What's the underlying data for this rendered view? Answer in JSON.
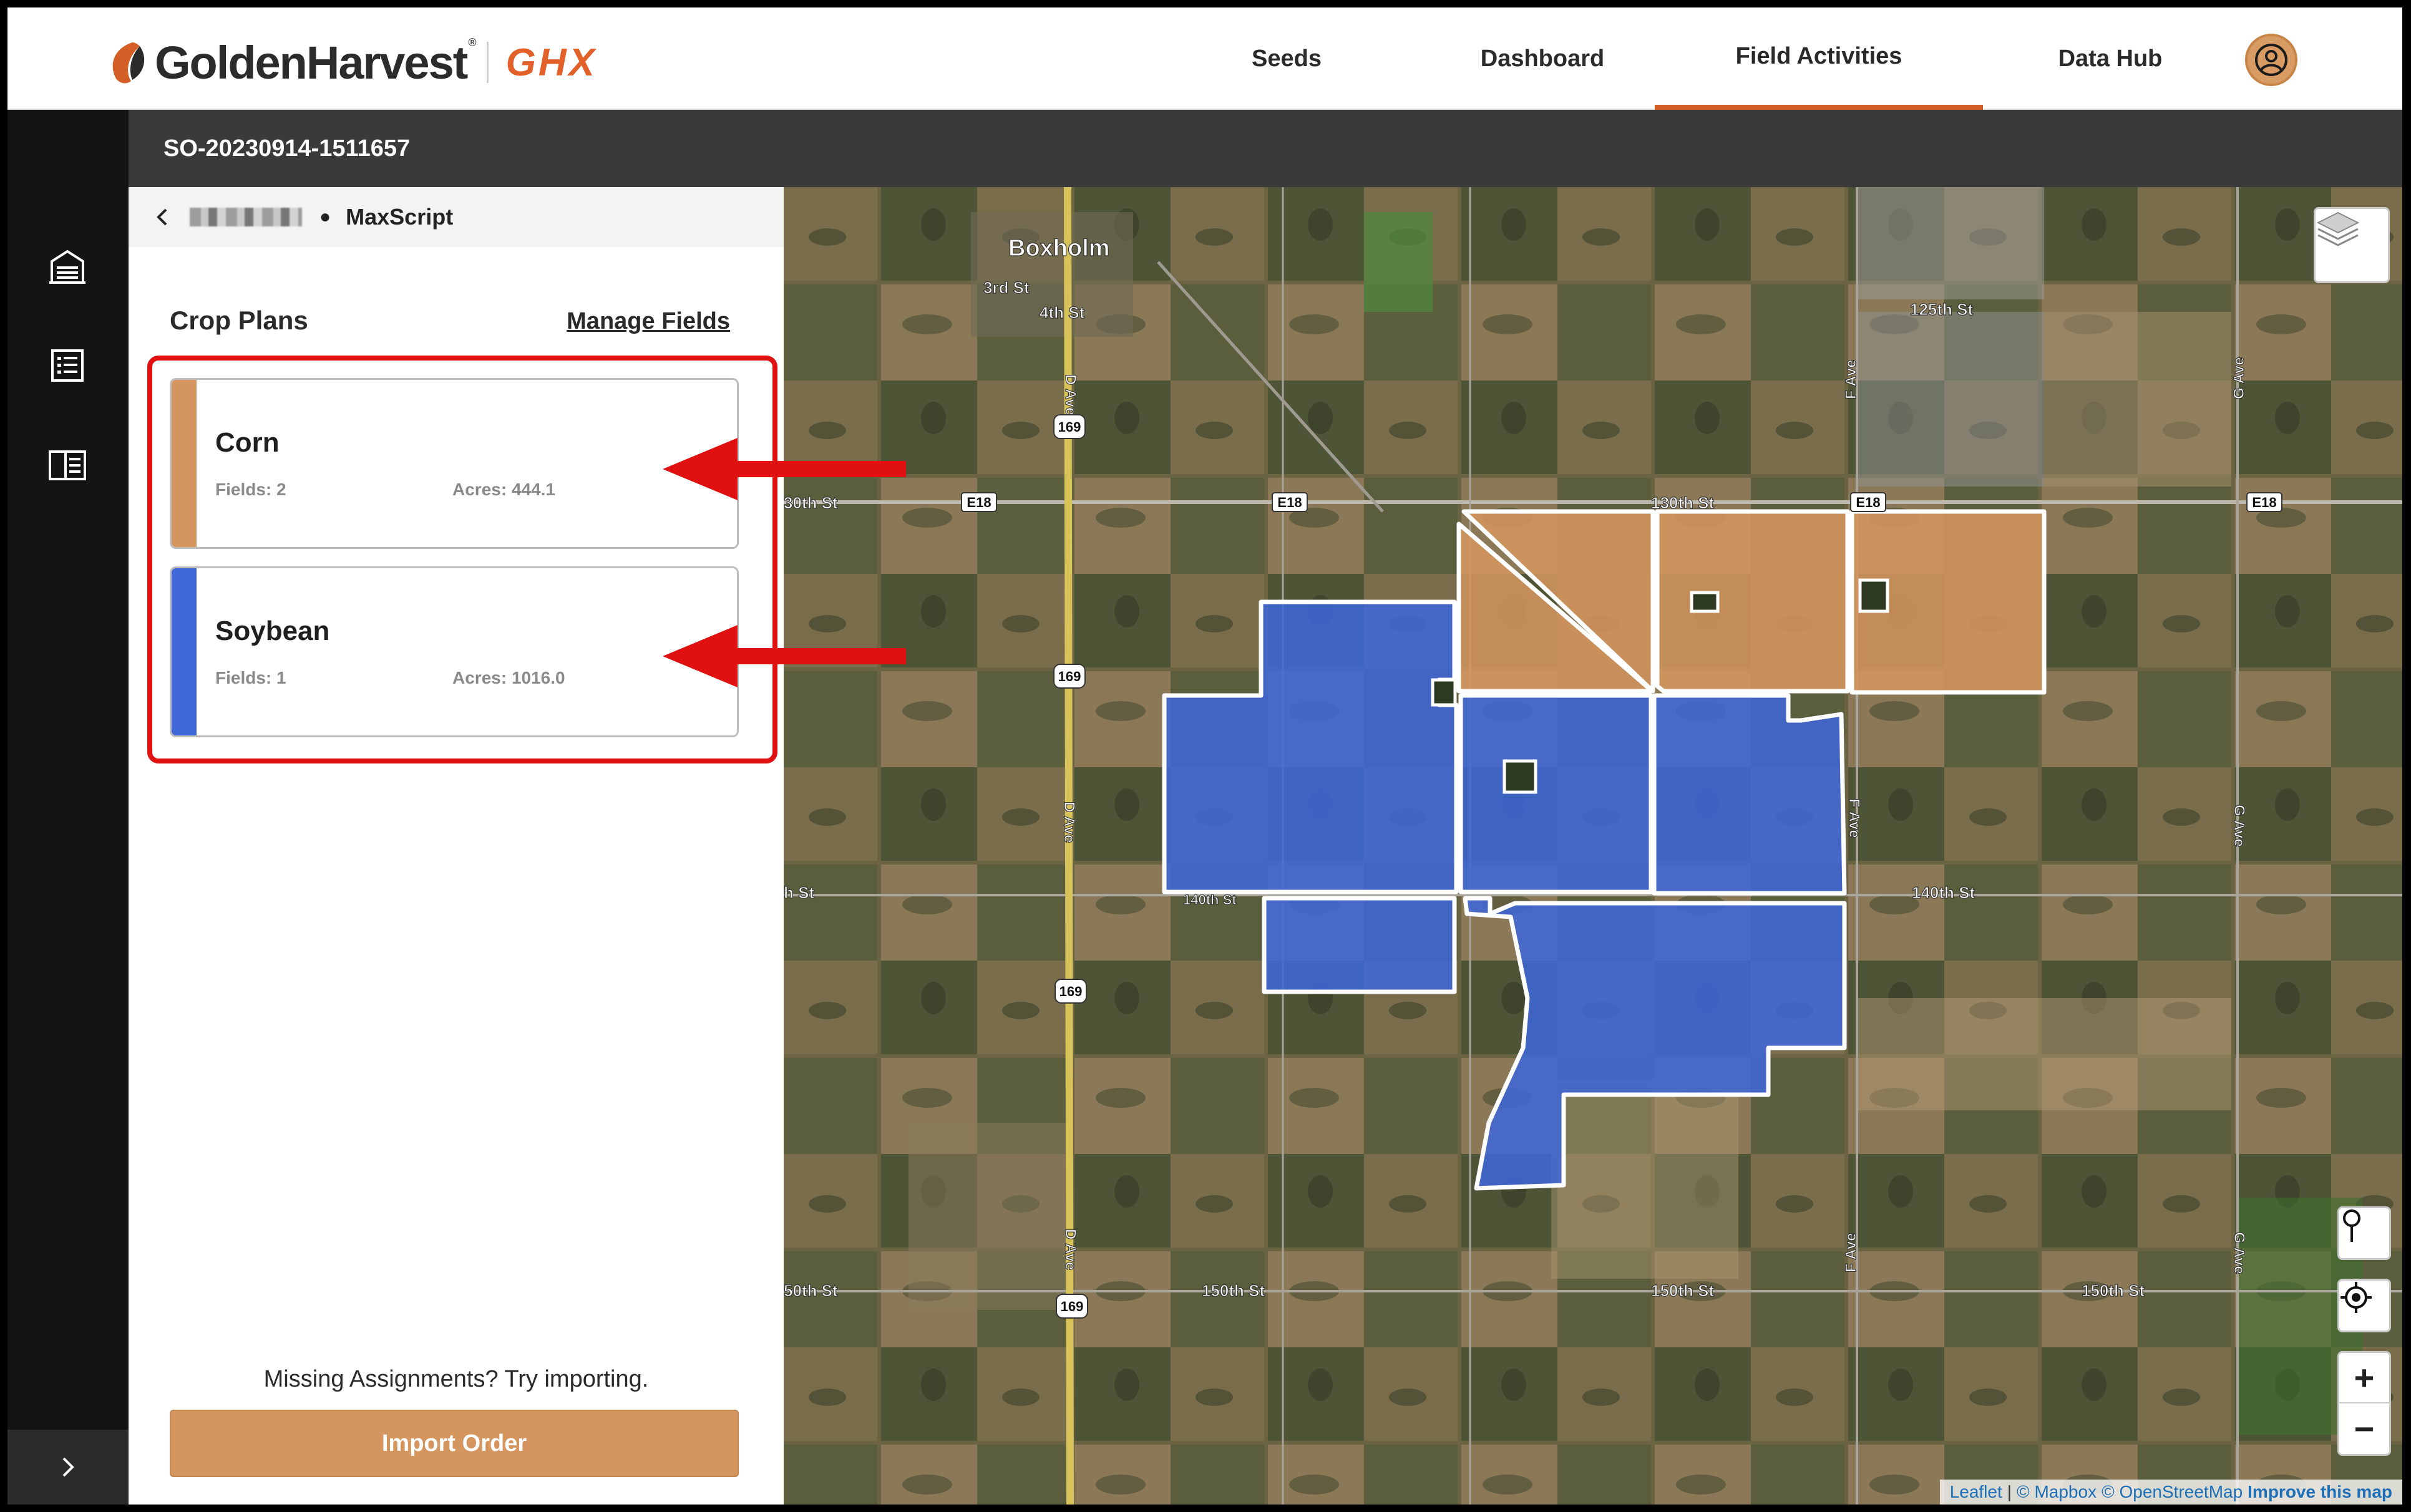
{
  "brand": {
    "name": "GoldenHarvest",
    "mark": "®",
    "product": "GHX",
    "accent": "#d35f26"
  },
  "nav": {
    "items": [
      {
        "label": "Seeds"
      },
      {
        "label": "Dashboard"
      },
      {
        "label": "Field Activities",
        "active": true
      },
      {
        "label": "Data Hub"
      }
    ]
  },
  "rail": {
    "icons": [
      "farm-building-icon",
      "list-icon",
      "book-icon"
    ],
    "expand_icon": "chevron-right-icon"
  },
  "subheader": {
    "order_id": "SO-20230914-1511657"
  },
  "breadcrumb": {
    "current": "MaxScript"
  },
  "crop_plans": {
    "title": "Crop Plans",
    "manage_label": "Manage Fields",
    "plans": [
      {
        "name": "Corn",
        "fields": "Fields: 2",
        "acres": "Acres: 444.1",
        "color": "#d4955f"
      },
      {
        "name": "Soybean",
        "fields": "Fields: 1",
        "acres": "Acres: 1016.0",
        "color": "#3f67d6"
      }
    ]
  },
  "import": {
    "hint": "Missing Assignments? Try importing.",
    "button_label": "Import Order"
  },
  "map": {
    "labels": {
      "town": "Boxholm",
      "st3": "3rd St",
      "st4": "4th St",
      "st125": "125th St",
      "st130": "130th St",
      "st140": "140th St",
      "st150a": "150th St",
      "st150b": "150th St",
      "st150c": "150th St",
      "st130_left": "30th St",
      "st140_left": "h St",
      "st150_left": "50th St",
      "st140_mid": "140th St",
      "d_ave1": "D Ave",
      "d_ave2": "D Ave",
      "d_ave3": "D Ave",
      "f_ave1": "F Ave",
      "f_ave2": "F Ave",
      "f_ave3": "F Ave",
      "g_ave1": "G Ave",
      "g_ave2": "G Ave",
      "g_ave3": "G Ave"
    },
    "shields": {
      "hwy": "169",
      "county": "E18"
    },
    "controls": {
      "layers": "layers-icon",
      "pin": "pin-icon",
      "locate": "locate-icon",
      "zoom_in": "+",
      "zoom_out": "−"
    },
    "attribution": {
      "leaflet": "Leaflet",
      "sep": "|",
      "mapbox": "© Mapbox",
      "osm": "© OpenStreetMap",
      "improve": "Improve this map"
    }
  }
}
